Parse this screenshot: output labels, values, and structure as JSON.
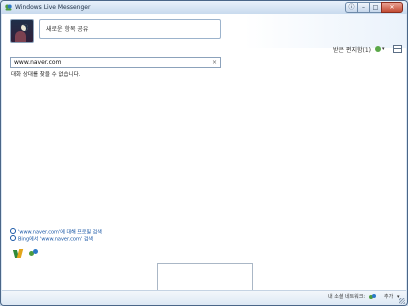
{
  "window": {
    "title": "Windows Live Messenger",
    "buttons": {
      "info_glyph": "ⓘ",
      "minimize_glyph": "–",
      "maximize_glyph": "□",
      "close_glyph": "✕"
    }
  },
  "profile": {
    "status_message": "새로운 항목 공유"
  },
  "toolbar": {
    "inbox_label": "받은 편지함(1)",
    "add_arrow": "▾"
  },
  "address": {
    "value": "www.naver.com",
    "clear_glyph": "×"
  },
  "error_text": "대화 상대를 찾을 수 없습니다.",
  "links": [
    {
      "text": "'www.naver.com'에 대해 프로필 검색"
    },
    {
      "text": "Bing에서 'www.naver.com' 검색"
    }
  ],
  "statusbar": {
    "network_label": "내 소셜 네트워크:",
    "add_label": "추가",
    "add_arrow": "▾"
  },
  "colors": {
    "accent": "#1957a6",
    "frame": "#4a6688",
    "close": "#c34b33"
  },
  "icons": [
    "windows-live-icon",
    "search-icon",
    "people-icon",
    "add-contact-icon",
    "menu-icon",
    "info-icon",
    "minimize-icon",
    "maximize-icon",
    "close-icon",
    "clear-icon",
    "resize-grip-icon"
  ]
}
